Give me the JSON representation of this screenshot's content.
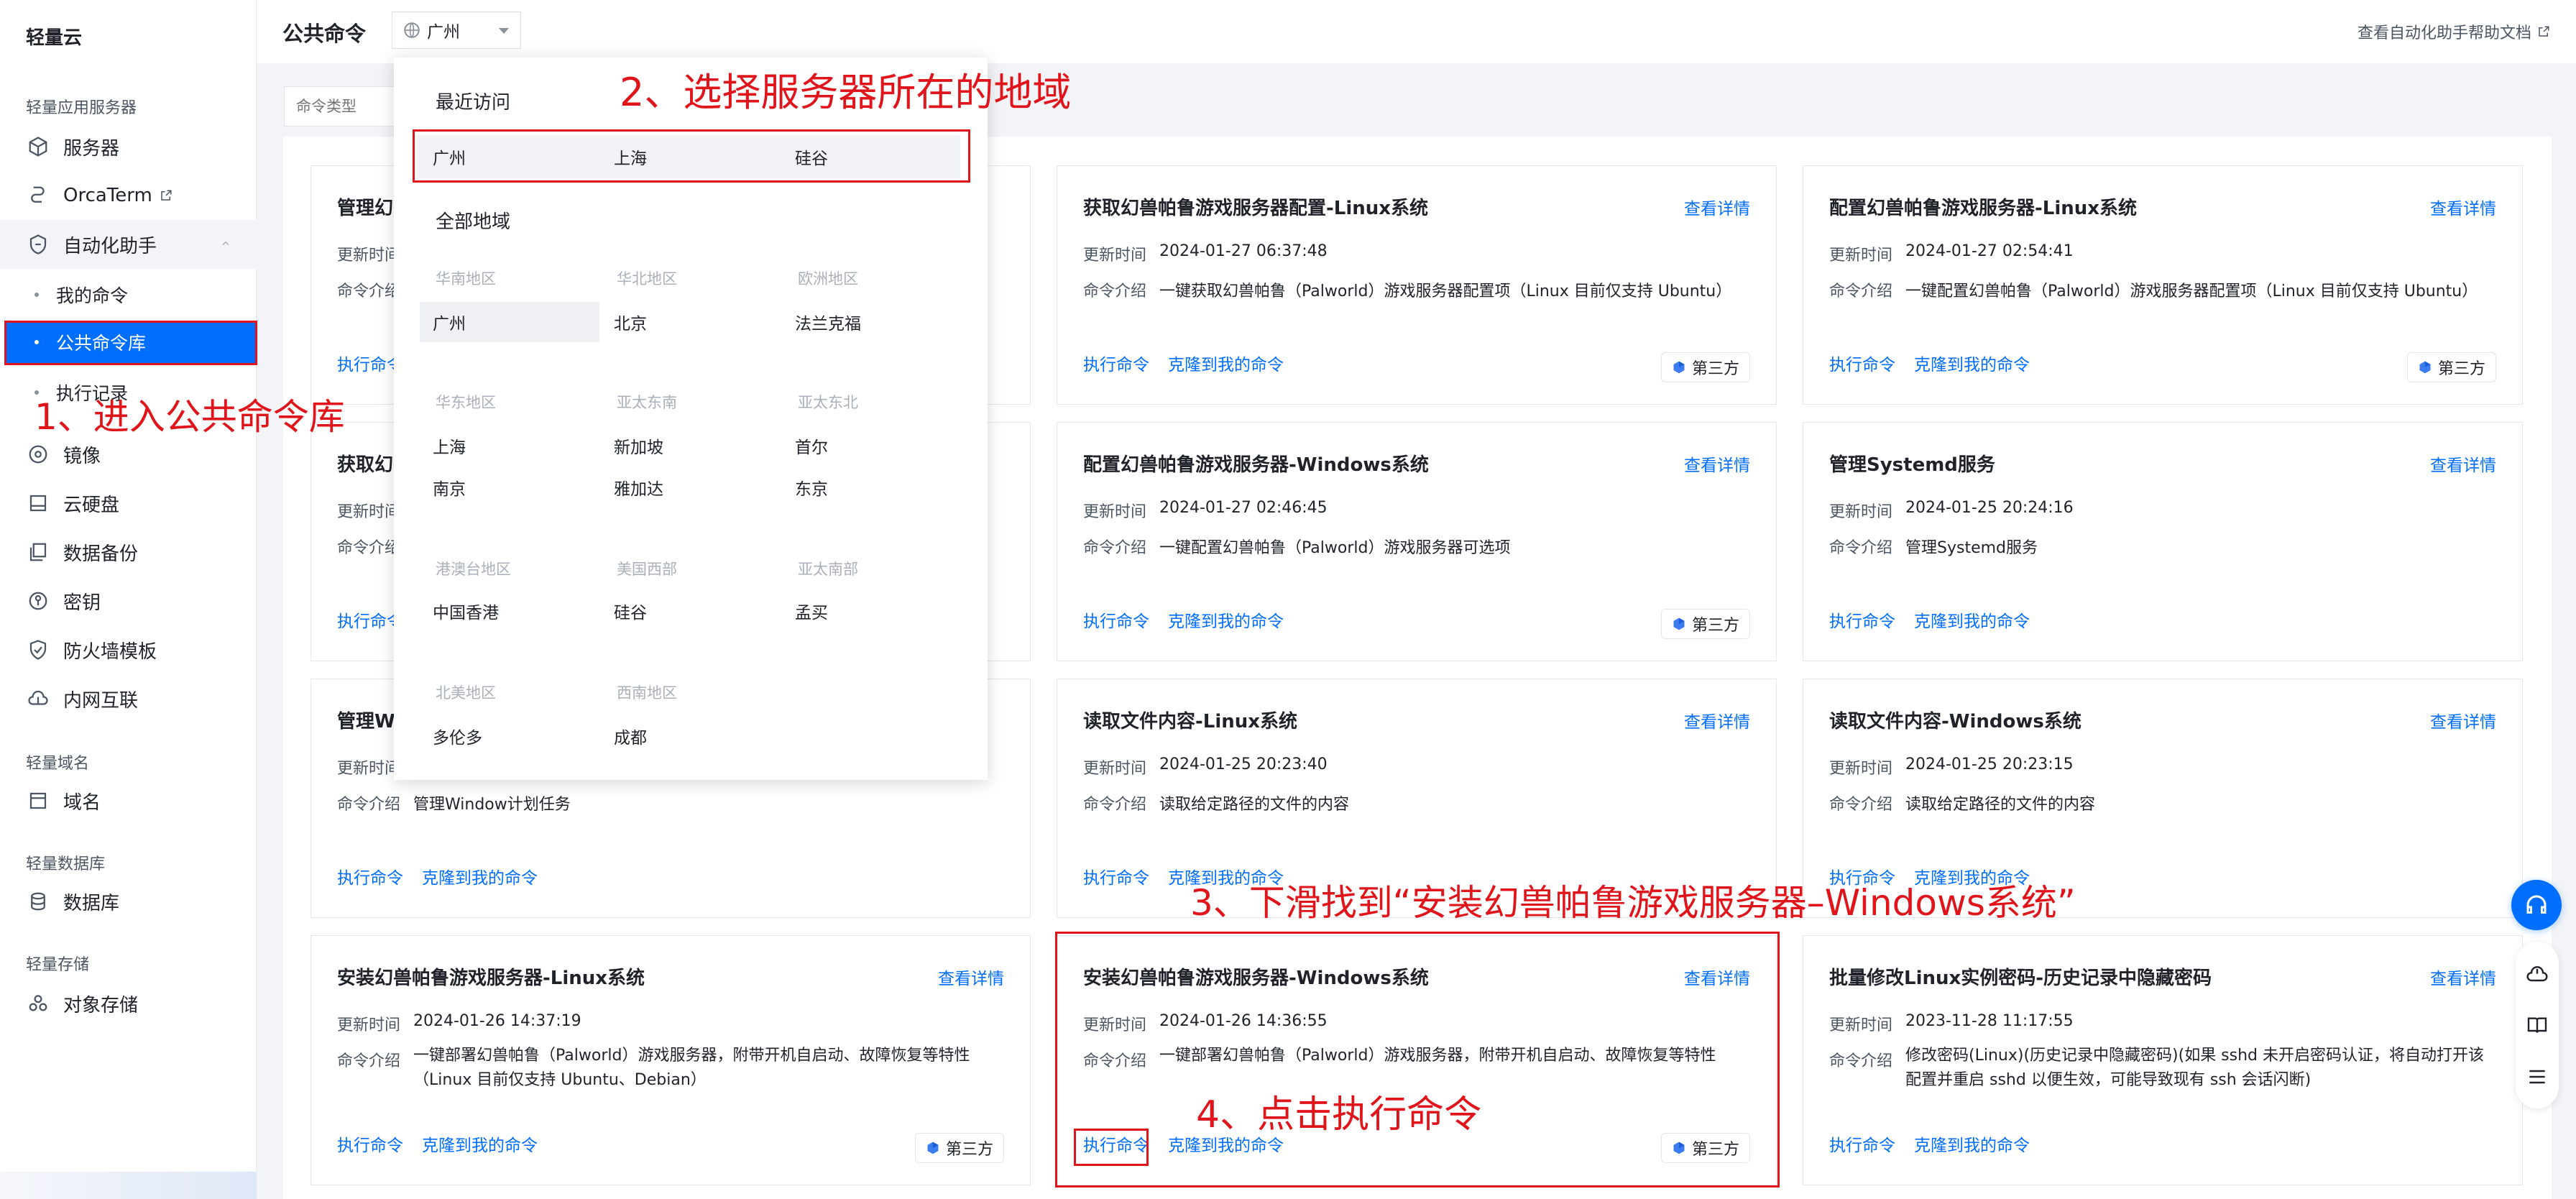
{
  "app": {
    "brand": "轻量云"
  },
  "sidebar": {
    "groups": [
      {
        "title": "轻量应用服务器"
      },
      {
        "title": "轻量域名"
      },
      {
        "title": "轻量数据库"
      },
      {
        "title": "轻量存储"
      }
    ],
    "items": [
      {
        "label": "服务器",
        "icon": "cube-icon"
      },
      {
        "label": "OrcaTerm",
        "icon": "terminal-icon"
      },
      {
        "label": "自动化助手",
        "icon": "robot-icon"
      },
      {
        "label": "镜像",
        "icon": "disc-icon"
      },
      {
        "label": "云硬盘",
        "icon": "disk-icon"
      },
      {
        "label": "数据备份",
        "icon": "backup-icon"
      },
      {
        "label": "密钥",
        "icon": "key-icon"
      },
      {
        "label": "防火墙模板",
        "icon": "shield-icon"
      },
      {
        "label": "内网互联",
        "icon": "network-icon"
      },
      {
        "label": "域名",
        "icon": "domain-icon"
      },
      {
        "label": "数据库",
        "icon": "database-icon"
      },
      {
        "label": "对象存储",
        "icon": "storage-icon"
      }
    ],
    "sub_items": [
      {
        "label": "我的命令"
      },
      {
        "label": "公共命令库"
      },
      {
        "label": "执行记录"
      }
    ]
  },
  "header": {
    "title": "公共命令",
    "region_value": "广州",
    "help_link": "查看自动化助手帮助文档"
  },
  "filter": {
    "placeholder": "命令类型"
  },
  "dropdown": {
    "recent_title": "最近访问",
    "recent": [
      "广州",
      "上海",
      "硅谷"
    ],
    "all_title": "全部地域",
    "areas": [
      {
        "name": "华南地区",
        "regions": [
          "广州"
        ]
      },
      {
        "name": "华北地区",
        "regions": [
          "北京"
        ]
      },
      {
        "name": "欧洲地区",
        "regions": [
          "法兰克福"
        ]
      },
      {
        "name": "华东地区",
        "regions": [
          "上海",
          "南京"
        ]
      },
      {
        "name": "亚太东南",
        "regions": [
          "新加坡",
          "雅加达"
        ]
      },
      {
        "name": "亚太东北",
        "regions": [
          "首尔",
          "东京"
        ]
      },
      {
        "name": "港澳台地区",
        "regions": [
          "中国香港"
        ]
      },
      {
        "name": "美国西部",
        "regions": [
          "硅谷"
        ]
      },
      {
        "name": "亚太南部",
        "regions": [
          "孟买"
        ]
      },
      {
        "name": "北美地区",
        "regions": [
          "多伦多"
        ]
      },
      {
        "name": "西南地区",
        "regions": [
          "成都"
        ]
      }
    ]
  },
  "labels": {
    "updated": "更新时间",
    "intro": "命令介绍",
    "detail": "查看详情",
    "run": "执行命令",
    "clone": "克隆到我的命令",
    "third_party": "第三方"
  },
  "cards": [
    {
      "title": "管理幻",
      "time": "",
      "desc": ""
    },
    {
      "title": "获取幻兽帕鲁游戏服务器配置-Linux系统",
      "time": "2024-01-27 06:37:48",
      "desc": "一键获取幻兽帕鲁（Palworld）游戏服务器配置项（Linux 目前仅支持 Ubuntu）"
    },
    {
      "title": "配置幻兽帕鲁游戏服务器-Linux系统",
      "time": "2024-01-27 02:54:41",
      "desc": "一键配置幻兽帕鲁（Palworld）游戏服务器配置项（Linux 目前仅支持 Ubuntu）"
    },
    {
      "title": "获取幻",
      "time": "",
      "desc": ""
    },
    {
      "title": "配置幻兽帕鲁游戏服务器-Windows系统",
      "time": "2024-01-27 02:46:45",
      "desc": "一键配置幻兽帕鲁（Palworld）游戏服务器可选项"
    },
    {
      "title": "管理Systemd服务",
      "time": "2024-01-25 20:24:16",
      "desc": "管理Systemd服务"
    },
    {
      "title": "管理Wi",
      "time": "",
      "desc": "管理Window计划任务"
    },
    {
      "title": "读取文件内容-Linux系统",
      "time": "2024-01-25 20:23:40",
      "desc": "读取给定路径的文件的内容"
    },
    {
      "title": "读取文件内容-Windows系统",
      "time": "2024-01-25 20:23:15",
      "desc": "读取给定路径的文件的内容"
    },
    {
      "title": "安装幻兽帕鲁游戏服务器-Linux系统",
      "time": "2024-01-26 14:37:19",
      "desc": "一键部署幻兽帕鲁（Palworld）游戏服务器，附带开机自启动、故障恢复等特性（Linux 目前仅支持 Ubuntu、Debian）"
    },
    {
      "title": "安装幻兽帕鲁游戏服务器-Windows系统",
      "time": "2024-01-26 14:36:55",
      "desc": "一键部署幻兽帕鲁（Palworld）游戏服务器，附带开机自启动、故障恢复等特性"
    },
    {
      "title": "批量修改Linux实例密码-历史记录中隐藏密码",
      "time": "2023-11-28 11:17:55",
      "desc": "修改密码(Linux)(历史记录中隐藏密码)(如果 sshd 未开启密码认证，将自动打开该配置并重启 sshd 以便生效，可能导致现有 ssh 会话闪断)"
    }
  ],
  "annotations": {
    "step1": "1、进入公共命令库",
    "step2": "2、选择服务器所在的地域",
    "step3": "3、下滑找到“安装幻兽帕鲁游戏服务器–Windows系统”",
    "step4": "4、点击执行命令"
  },
  "colors": {
    "accent": "#006eff",
    "annotation": "#e0151b",
    "sidebar_active": "#006eff"
  }
}
